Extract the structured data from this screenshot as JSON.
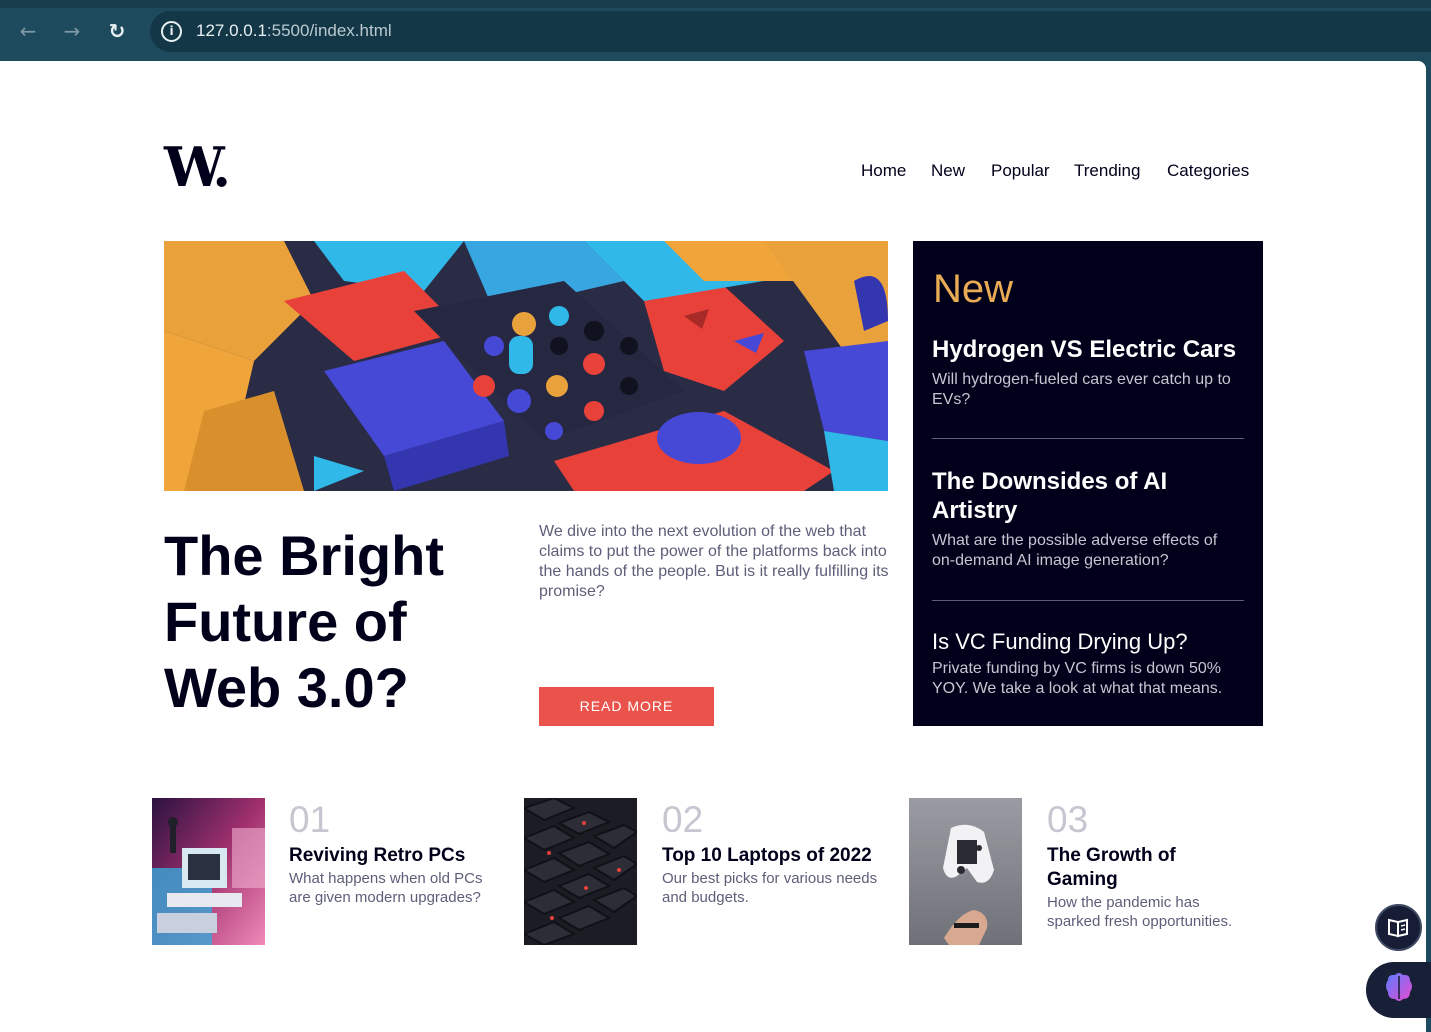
{
  "browser": {
    "url_host": "127.0.0.1",
    "url_rest": ":5500/index.html",
    "back_icon": "arrow-left-icon",
    "forward_icon": "arrow-right-icon",
    "reload_icon": "reload-icon",
    "info_icon": "info-icon"
  },
  "site": {
    "logo": "W.",
    "nav": [
      "Home",
      "New",
      "Popular",
      "Trending",
      "Categories"
    ]
  },
  "hero": {
    "title": "The Bright Future of Web 3.0?",
    "description": "We dive into the next evolution of the web that claims to put the power of the platforms back into the hands of the people. But is it really fulfilling its promise?",
    "button": "READ MORE"
  },
  "new_section": {
    "heading": "New",
    "items": [
      {
        "title": "Hydrogen VS Electric Cars",
        "text": "Will hydrogen-fueled cars ever catch up to EVs?"
      },
      {
        "title": "The Downsides of AI Artistry",
        "text": "What are the possible adverse effects of on-demand AI image generation?"
      },
      {
        "title": "Is VC Funding Drying Up?",
        "text": "Private funding by VC firms is down 50% YOY. We take a look at what that means."
      }
    ]
  },
  "articles": [
    {
      "num": "01",
      "title": "Reviving Retro PCs",
      "text": "What happens when old PCs are given modern upgrades?"
    },
    {
      "num": "02",
      "title": "Top 10 Laptops of 2022",
      "text": "Our best picks for various needs and budgets."
    },
    {
      "num": "03",
      "title": "The Growth of Gaming",
      "text": "How the pandemic has sparked fresh opportunities."
    }
  ],
  "colors": {
    "brand_dark": "#00001a",
    "accent_red": "#e9534b",
    "accent_orange": "#e9ab53",
    "text_muted": "#5d5f79",
    "chrome": "#1d4a5c"
  },
  "floating": {
    "reader_icon": "open-book-icon",
    "assistant_icon": "brain-icon"
  }
}
